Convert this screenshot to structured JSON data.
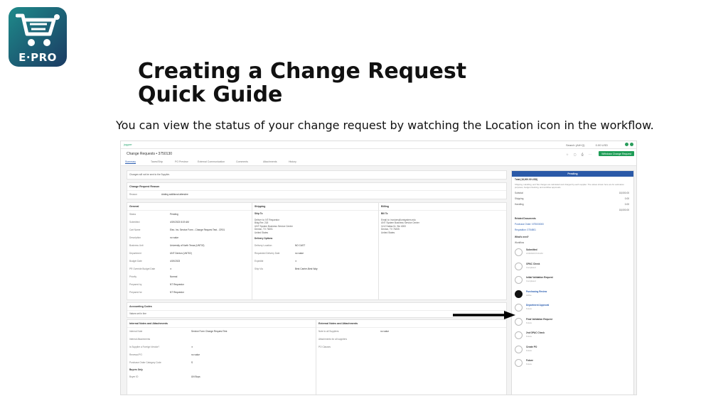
{
  "logo": {
    "text": "E·PRO",
    "icon": "cart-icon"
  },
  "title": "Creating a Change Request Quick Guide",
  "subtitle": "You can view the status of your change request by watching the Location icon in the workflow.",
  "screenshot": {
    "topbar": {
      "app": "jaggaer",
      "right1": "Search (Alt+Q)",
      "right2": "0.00 USD"
    },
    "header": {
      "breadcrumb": "Change Requests • 3750130",
      "button": "Withdraw Change Request"
    },
    "tabs": [
      "Summary",
      "Taxes/Ship",
      "PO Preview",
      "External Communication",
      "Comments",
      "Attachments",
      "History"
    ],
    "notice": "Changes will not be sent to the Supplier.",
    "change_reason": {
      "title": "Change Request Reason",
      "label": "Reason",
      "value": "Adding additional attendee"
    },
    "general": {
      "title": "General",
      "rows": [
        {
          "k": "Status",
          "v": "Pending"
        },
        {
          "k": "Submitted",
          "v": "4/19/2023 8:19 AM"
        },
        {
          "k": "Cart Name",
          "v": "Elec. Inv. Service Form - Change Request Test - CR01"
        },
        {
          "k": "Description",
          "v": "no value"
        },
        {
          "k": "Business Unit",
          "v": "University of North Texas (UNT02)"
        },
        {
          "k": "Department",
          "v": "UNT Denton (UNT02)"
        },
        {
          "k": "Budget Date",
          "v": "4/19/2023"
        },
        {
          "k": "PR Override Budget Date",
          "v": "✕"
        },
        {
          "k": "Priority",
          "v": "Normal"
        },
        {
          "k": "Prepared by",
          "v": "NT Requestor"
        },
        {
          "k": "Prepared for",
          "v": "NT Requestor"
        }
      ]
    },
    "shipping": {
      "title": "Shipping",
      "ship_to": "Ship To",
      "address": "Deliver to: NT Requestor\nBldg Rm: 218\nUNT System Business Service Center\nDenton, TX 76201\nUnited States",
      "delivery_title": "Delivery Options",
      "rows": [
        {
          "k": "Delivery Location",
          "v": "NO CAST"
        },
        {
          "k": "Requested Delivery Date",
          "v": "no value"
        },
        {
          "k": "Expedite",
          "v": "✕"
        },
        {
          "k": "Ship Via",
          "v": "Best Carrier-Best Way"
        }
      ]
    },
    "billing": {
      "title": "Billing",
      "bill_to": "Bill To",
      "address": "Email to: invoices@untsystem.edu\nUNT System Business Service Center\n1112 Dallas Dr. Ste 4000\nDenton, TX 76205\nUnited States"
    },
    "accounting": {
      "title": "Accounting Codes",
      "value": "Values set in line"
    },
    "internal": {
      "title": "Internal Notes and Attachments",
      "rows": [
        {
          "k": "Internal Note",
          "v": "Service Form Change Request Test"
        },
        {
          "k": "Internal Attachments",
          "v": ""
        },
        {
          "k": "Is Supplier a Foreign Vendor?",
          "v": "✕"
        },
        {
          "k": "Renewal PO",
          "v": "no value"
        },
        {
          "k": "Purchase Order Category Code",
          "v": "S"
        }
      ],
      "subtitle": "Buyers Only",
      "buyer_k": "Buyer ID",
      "buyer_v": "UN Buys"
    },
    "external": {
      "title": "External Notes and Attachments",
      "rows": [
        {
          "k": "Note to all Suppliers",
          "v": "no value"
        },
        {
          "k": "Attachments for all suppliers",
          "v": ""
        },
        {
          "k": "PO Clauses",
          "v": ""
        }
      ]
    },
    "sidebar": {
      "status": "Pending",
      "total": "Total (18,000.00 USD)",
      "total_note": "Shipping, Handling, and Tax charges are calculated and charged by each supplier. The values shown here are for estimation purposes, budget checking, and workflow approvals.",
      "lines": [
        {
          "k": "Subtotal",
          "v": "18,000.00"
        },
        {
          "k": "Shipping",
          "v": "0.00"
        },
        {
          "k": "Handling",
          "v": "0.00"
        },
        {
          "k": "",
          "v": "18,000.00"
        }
      ],
      "related": "Related Documents",
      "related_items": [
        "Purchase Order: NT5000000",
        "Requisition: 3754801"
      ],
      "whats_next": "What's next?",
      "workflow_label": "Workflow",
      "steps": [
        {
          "name": "Submitted",
          "sub": "4/19/2023 8:19 AM",
          "location": false
        },
        {
          "name": "OPAC Check",
          "sub": "Completed",
          "location": false
        },
        {
          "name": "Initial Validation Request",
          "sub": "Completed",
          "location": false
        },
        {
          "name": "Purchasing Review",
          "sub": "Active",
          "location": true
        },
        {
          "name": "Department Approval",
          "sub": "Future",
          "location": false
        },
        {
          "name": "Final Validation Request",
          "sub": "Future",
          "location": false
        },
        {
          "name": "2nd OPAC Check",
          "sub": "Future",
          "location": false
        },
        {
          "name": "Create PO",
          "sub": "Future",
          "location": false
        },
        {
          "name": "Future",
          "sub": "Future",
          "location": false
        }
      ]
    }
  }
}
